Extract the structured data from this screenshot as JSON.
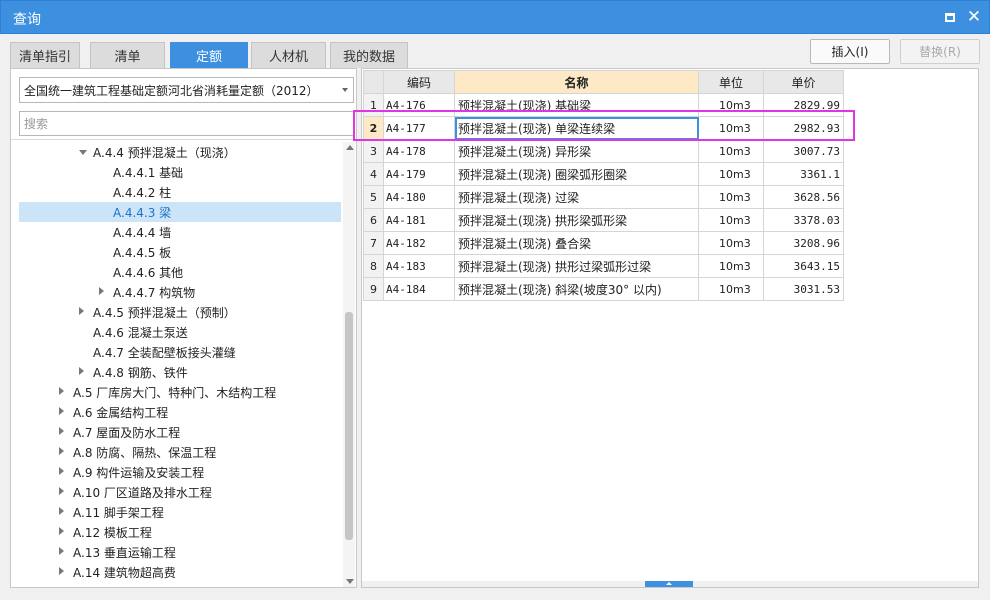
{
  "window": {
    "title": "查询"
  },
  "tabs": [
    {
      "label": "清单指引"
    },
    {
      "label": "清单"
    },
    {
      "label": "定额"
    },
    {
      "label": "人材机"
    },
    {
      "label": "我的数据"
    }
  ],
  "active_tab": "定额",
  "buttons": {
    "insert": "插入(I)",
    "replace": "替换(R)"
  },
  "left": {
    "library": "全国统一建筑工程基础定额河北省消耗量定额（2012）",
    "search_placeholder": "搜索",
    "tree": [
      {
        "label": "A.4.4 预拌混凝土（现浇）",
        "expander": "down"
      },
      {
        "label": "A.4.4.1 基础",
        "expander": "none"
      },
      {
        "label": "A.4.4.2 柱",
        "expander": "none"
      },
      {
        "label": "A.4.4.3 梁",
        "expander": "none",
        "selected": true
      },
      {
        "label": "A.4.4.4 墙",
        "expander": "none"
      },
      {
        "label": "A.4.4.5 板",
        "expander": "none"
      },
      {
        "label": "A.4.4.6 其他",
        "expander": "none"
      },
      {
        "label": "A.4.4.7 构筑物",
        "expander": "right"
      },
      {
        "label": "A.4.5 预拌混凝土（预制）",
        "expander": "right"
      },
      {
        "label": "A.4.6 混凝土泵送",
        "expander": "none"
      },
      {
        "label": "A.4.7 全装配壁板接头灌缝",
        "expander": "none"
      },
      {
        "label": "A.4.8 钢筋、铁件",
        "expander": "right"
      },
      {
        "label": "A.5 厂库房大门、特种门、木结构工程",
        "expander": "right"
      },
      {
        "label": "A.6 金属结构工程",
        "expander": "right"
      },
      {
        "label": "A.7 屋面及防水工程",
        "expander": "right"
      },
      {
        "label": "A.8 防腐、隔热、保温工程",
        "expander": "right"
      },
      {
        "label": "A.9 构件运输及安装工程",
        "expander": "right"
      },
      {
        "label": "A.10 厂区道路及排水工程",
        "expander": "right"
      },
      {
        "label": "A.11 脚手架工程",
        "expander": "right"
      },
      {
        "label": "A.12 模板工程",
        "expander": "right"
      },
      {
        "label": "A.13 垂直运输工程",
        "expander": "right"
      },
      {
        "label": "A.14 建筑物超高费",
        "expander": "right"
      }
    ]
  },
  "table": {
    "headers": [
      "编码",
      "名称",
      "单位",
      "单价"
    ],
    "rows": [
      {
        "no": "1",
        "code": "A4-176",
        "name": "预拌混凝土(现浇) 基础梁",
        "unit": "10m3",
        "price": "2829.99"
      },
      {
        "no": "2",
        "code": "A4-177",
        "name": "预拌混凝土(现浇) 单梁连续梁",
        "unit": "10m3",
        "price": "2982.93",
        "current": true
      },
      {
        "no": "3",
        "code": "A4-178",
        "name": "预拌混凝土(现浇) 异形梁",
        "unit": "10m3",
        "price": "3007.73"
      },
      {
        "no": "4",
        "code": "A4-179",
        "name": "预拌混凝土(现浇) 圈梁弧形圈梁",
        "unit": "10m3",
        "price": "3361.1"
      },
      {
        "no": "5",
        "code": "A4-180",
        "name": "预拌混凝土(现浇) 过梁",
        "unit": "10m3",
        "price": "3628.56"
      },
      {
        "no": "6",
        "code": "A4-181",
        "name": "预拌混凝土(现浇) 拱形梁弧形梁",
        "unit": "10m3",
        "price": "3378.03"
      },
      {
        "no": "7",
        "code": "A4-182",
        "name": "预拌混凝土(现浇) 叠合梁",
        "unit": "10m3",
        "price": "3208.96"
      },
      {
        "no": "8",
        "code": "A4-183",
        "name": "预拌混凝土(现浇) 拱形过梁弧形过梁",
        "unit": "10m3",
        "price": "3643.15"
      },
      {
        "no": "9",
        "code": "A4-184",
        "name": "预拌混凝土(现浇) 斜梁(坡度30° 以内)",
        "unit": "10m3",
        "price": "3031.53"
      }
    ]
  },
  "colors": {
    "accent": "#3d8fe0",
    "highlight": "#e135e1",
    "selected_row": "#cce4f7",
    "header_current": "#fde9c5"
  }
}
